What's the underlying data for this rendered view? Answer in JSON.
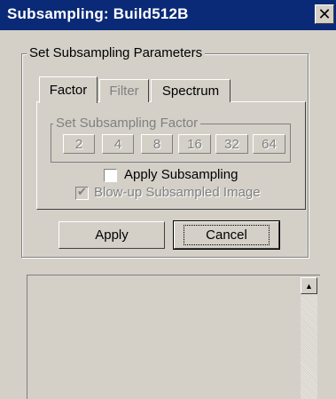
{
  "window": {
    "title": "Subsampling: Build512B",
    "close_glyph": "✕"
  },
  "group": {
    "label": "Set Subsampling Parameters"
  },
  "tabs": [
    {
      "label": "Factor",
      "active": true
    },
    {
      "label": "Filter",
      "disabled": true
    },
    {
      "label": "Spectrum"
    }
  ],
  "factor": {
    "label": "Set Subsampling Factor",
    "values": [
      "2",
      "4",
      "8",
      "16",
      "32",
      "64"
    ]
  },
  "options": {
    "apply_subsampling": {
      "label": "Apply Subsampling",
      "checked": false
    },
    "blow_up": {
      "label": "Blow-up Subsampled Image",
      "checked": true,
      "disabled": true
    }
  },
  "buttons": {
    "apply": "Apply",
    "cancel": "Cancel"
  },
  "scroll": {
    "up_glyph": "▲"
  },
  "colors": {
    "titlebar": "#0a2a78",
    "face": "#d4d0c8",
    "disabled_text": "#808080"
  }
}
